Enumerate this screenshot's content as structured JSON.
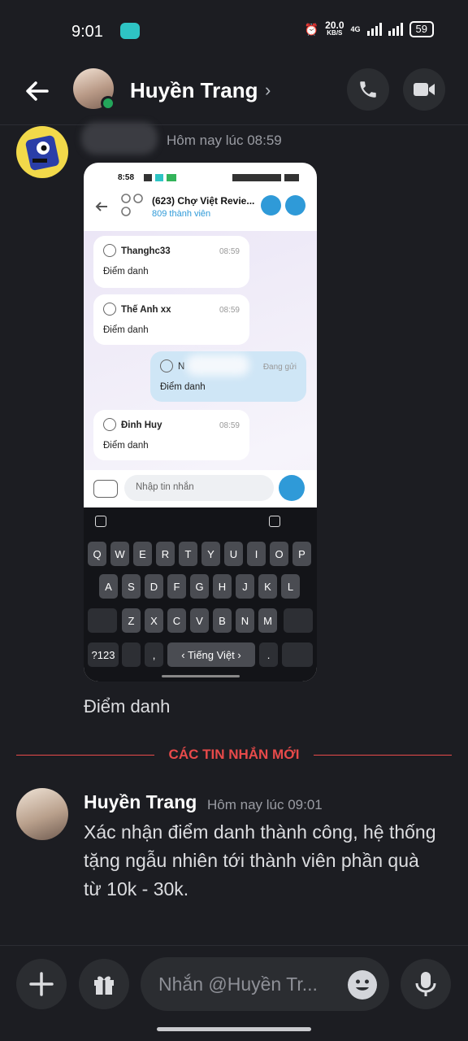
{
  "status": {
    "time": "9:01",
    "net_speed": "20.0",
    "net_unit": "KB/S",
    "net_type": "4G",
    "battery": "59"
  },
  "header": {
    "name": "Huyền Trang",
    "chevron": "›",
    "back_icon": "arrow-left-icon",
    "call_icon": "phone-icon",
    "video_icon": "video-icon"
  },
  "message1": {
    "timestamp": "Hôm nay lúc 08:59",
    "caption": "Điểm danh",
    "screenshot": {
      "status_time": "8:58",
      "chat_title": "(623) Chợ Việt Revie...",
      "chat_members": "809 thành viên",
      "bubbles": [
        {
          "name": "Thanghc33",
          "time": "08:59",
          "body": "Điểm danh"
        },
        {
          "name": "Thế Anh xx",
          "time": "08:59",
          "body": "Điểm danh"
        },
        {
          "name": "N",
          "time": "Đang gửi",
          "body": "Điểm danh"
        },
        {
          "name": "Đinh Huy",
          "time": "08:59",
          "body": "Điểm danh"
        }
      ],
      "input_placeholder": "Nhập tin nhắn",
      "keyboard": {
        "row1": [
          "Q",
          "W",
          "E",
          "R",
          "T",
          "Y",
          "U",
          "I",
          "O",
          "P"
        ],
        "row2": [
          "A",
          "S",
          "D",
          "F",
          "G",
          "H",
          "J",
          "K",
          "L"
        ],
        "row3": [
          "Z",
          "X",
          "C",
          "V",
          "B",
          "N",
          "M"
        ],
        "sym": "?123",
        "comma": ",",
        "space": "‹ Tiếng Việt ›",
        "dot": "."
      }
    }
  },
  "divider": {
    "label": "CÁC TIN NHẮN MỚI",
    "color": "#e84a4a"
  },
  "message2": {
    "author": "Huyền Trang",
    "timestamp": "Hôm nay lúc 09:01",
    "text": "Xác nhận điểm danh thành công, hệ thống tặng ngẫu nhiên tới thành viên phần quà từ 10k - 30k."
  },
  "composer": {
    "placeholder": "Nhắn @Huyền Tr...",
    "plus_icon": "plus-icon",
    "gift_icon": "gift-icon",
    "emoji_icon": "emoji-icon",
    "mic_icon": "microphone-icon"
  }
}
